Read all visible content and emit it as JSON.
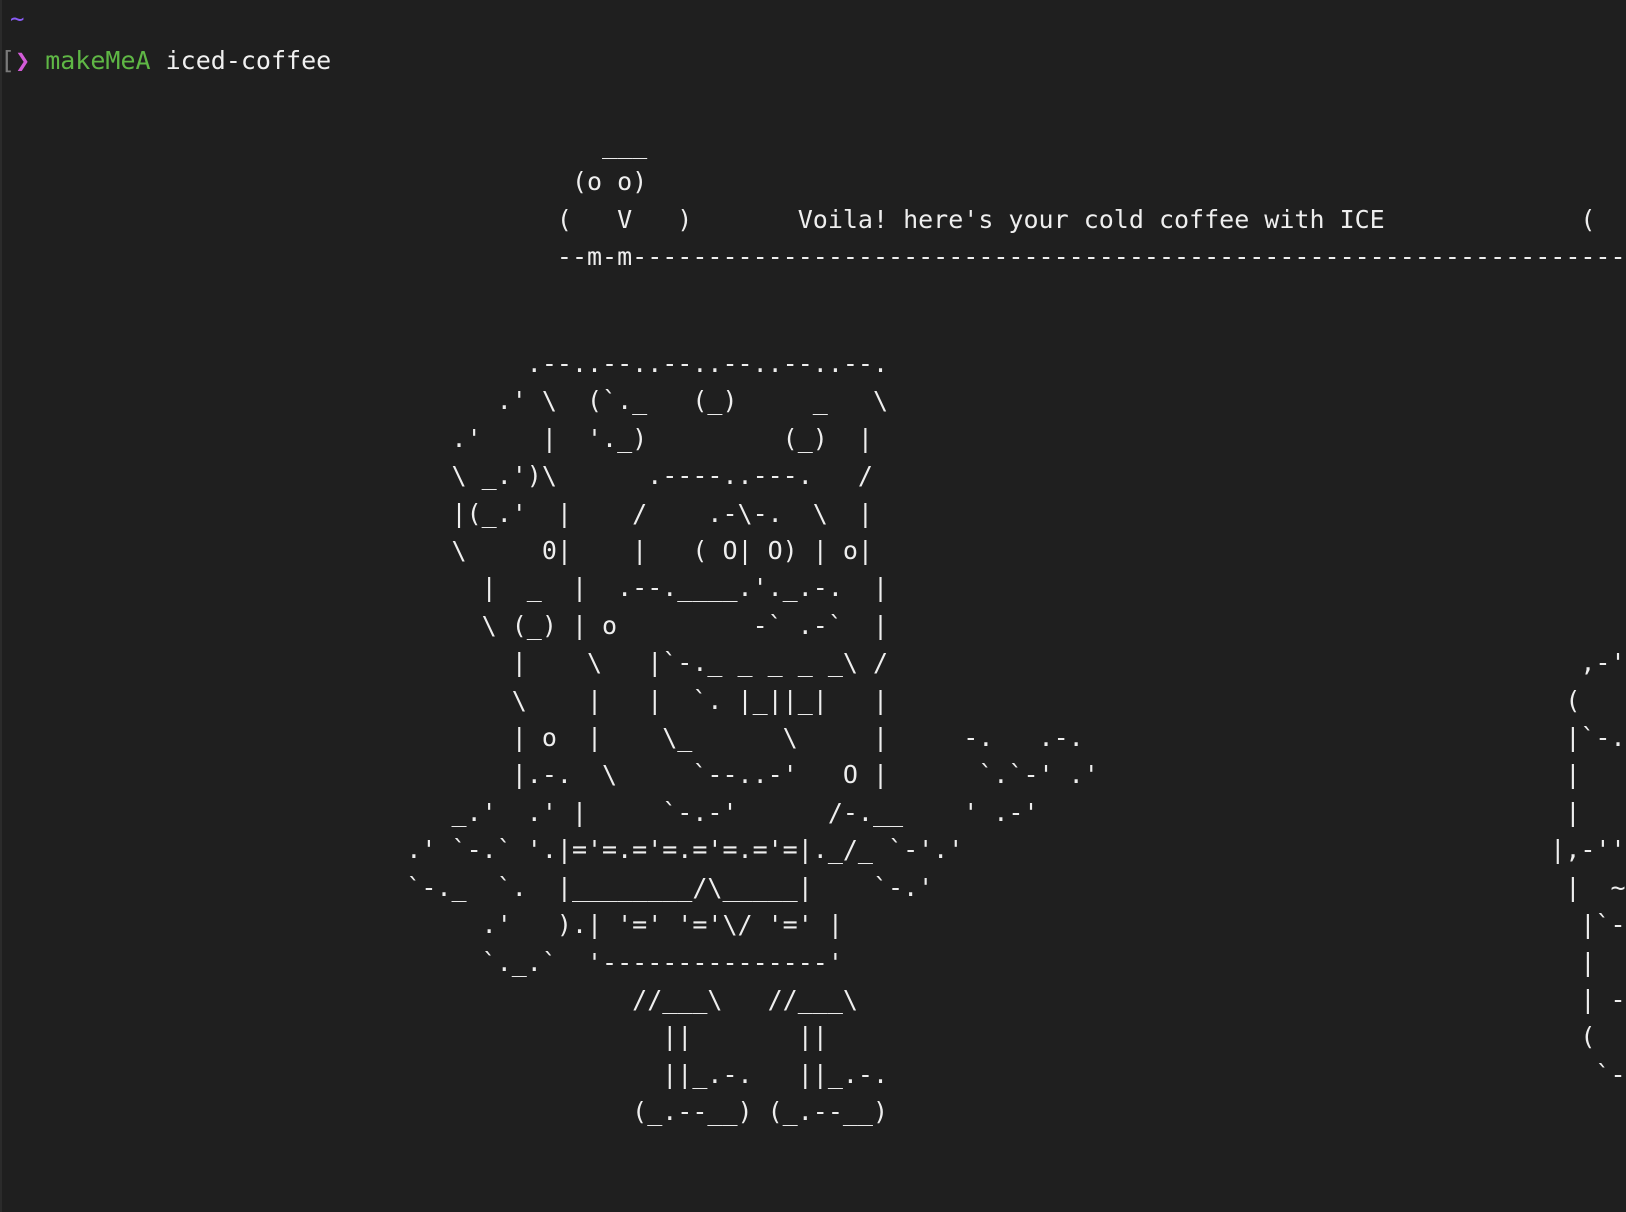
{
  "terminal": {
    "cwd": "~",
    "prompt_bracket": "[",
    "prompt_symbol": "❯",
    "command": "makeMeA",
    "argument": "iced-coffee"
  },
  "output": {
    "banner": "                                        ___                                                                                         ___\n                                      (o o)                                                                                     (o o)\n                                     (   V   )       Voila! here's your cold coffee with ICE             (   V   )\n                                     --m-m-------------------------------------------------------------------------m-m--",
    "art": "                                   .--..--..--..--..--..--.\n                                 .' \\  (`._   (_)     _   \\\n                              .'    |  '._)         (_)  |\n                              \\ _.')\\      .----..---.   /                                                                  //\n                              |(_.'  |    /    .-\\-.  \\  |                                                                 //\n                              \\     0|    |   ( O| O) | o|                                                                //\n                                |  _  |  .--.____.'._.-.  |                                                              //\n                                \\ (_) | o         -` .-`  |                                                  _______||\n                                  |    \\   |`-._ _ _ _ _\\ /                                              ,-'''       ||`-.\n                                  \\    |   |  `. |_||_|   |                                             (            ||   )\n                                  | o  |    \\_      \\     |     -.   .-.                                |`-..._______,..-'|\n                                  |.-.  \\     `--..-'   O |      `.`-' .'                               |            ||   |\n                              _.'  .' |     `-.-'      /-.__    ' .-'                                   |    _______||   |\n                           .' `-.` '.|='=.='=.='=.='=|._/_ `-'.'                                       |,-'''_ _  ~ ||`-.|\n                           `-._  `.  |________/\\_____|    `-.'                                          |  ~ / `-.\\ ,-'\\ ~|\n                                .'   ).| '=' '='\\/ '=' |                                                 |`-...___/___,..-'|\n                                `._.`  '---------------'                                                 |    `-./-'_ \\/_| |\n                                          //___\\   //___\\                                                | -'  ~~     || -.|\n                                            ||       ||                                                  (   ~      ~   ~~ )\n                                            ||_.-.   ||_.-.                                               `-..._______,..-'\n                                          (_.--__) (_.--__)"
  }
}
